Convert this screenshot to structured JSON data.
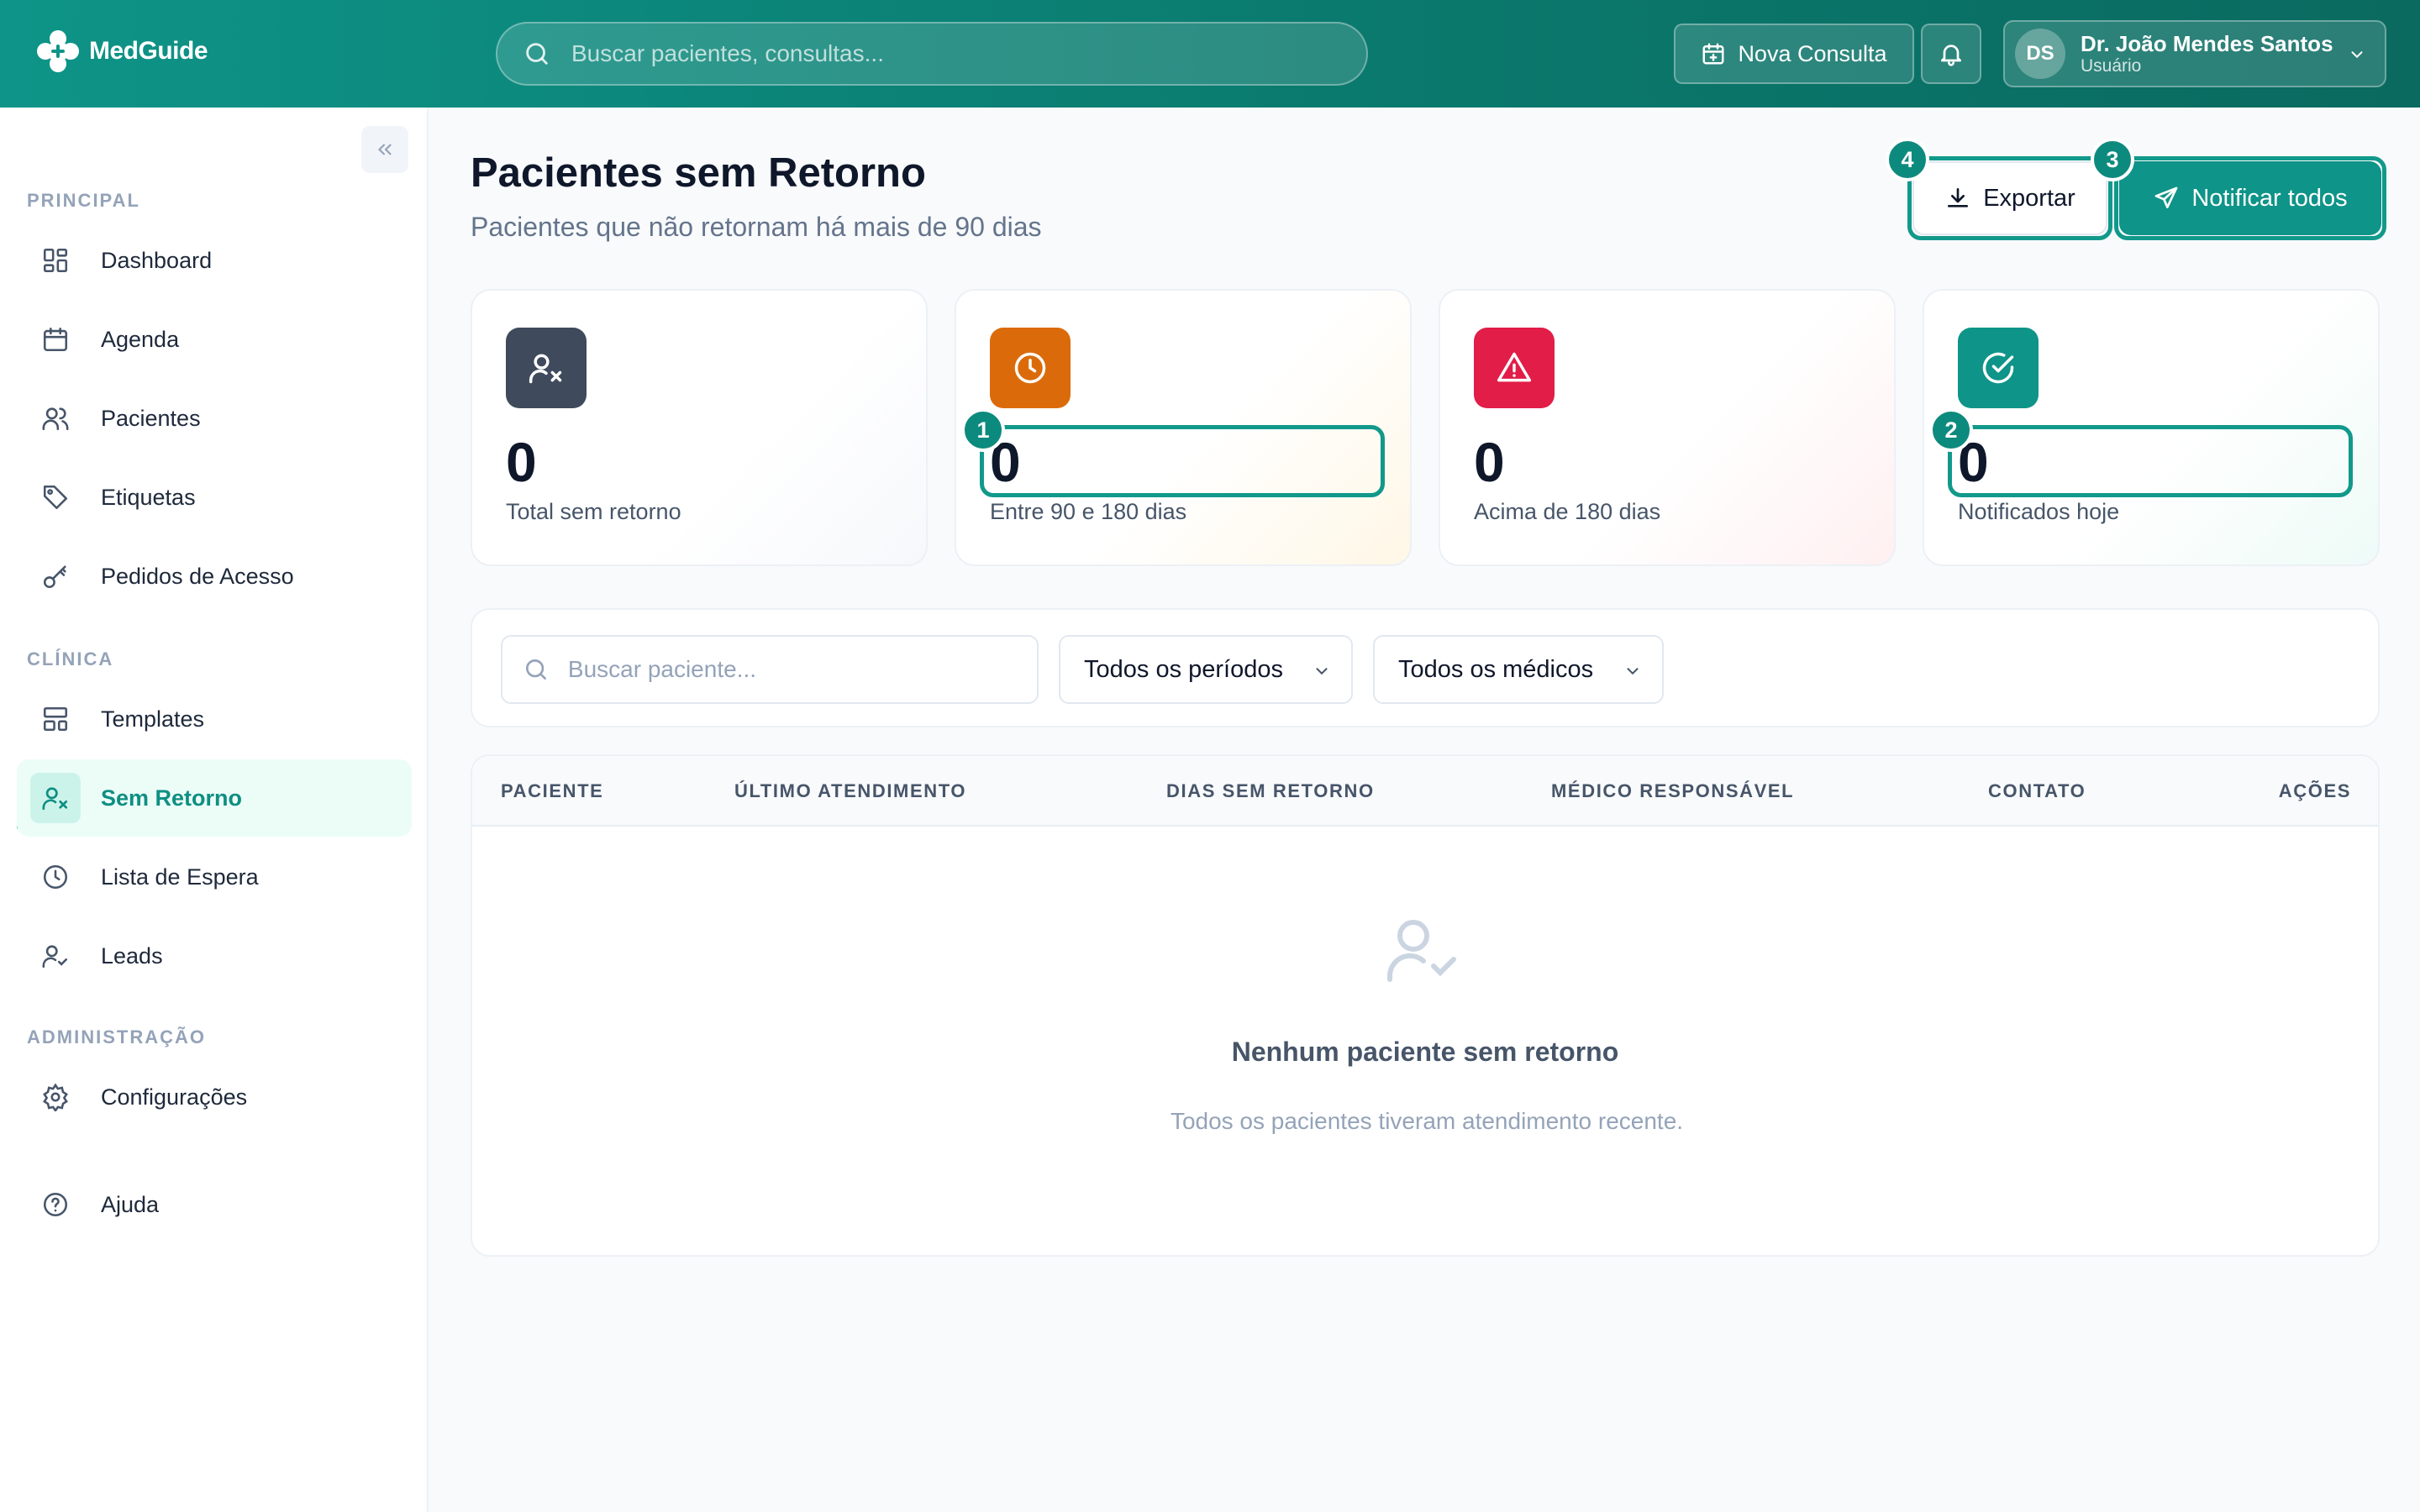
{
  "app": {
    "name": "MedGuide",
    "search_placeholder": "Buscar pacientes, consultas...",
    "new_consult_label": "Nova Consulta",
    "user": {
      "initials": "DS",
      "name": "Dr. João Mendes Santos",
      "role": "Usuário"
    }
  },
  "sidebar": {
    "sections": [
      {
        "label": "PRINCIPAL"
      },
      {
        "label": "CLÍNICA"
      },
      {
        "label": "ADMINISTRAÇÃO"
      }
    ],
    "items": [
      {
        "label": "Dashboard",
        "icon": "dashboard-icon"
      },
      {
        "label": "Agenda",
        "icon": "calendar-icon"
      },
      {
        "label": "Pacientes",
        "icon": "users-icon"
      },
      {
        "label": "Etiquetas",
        "icon": "tag-icon"
      },
      {
        "label": "Pedidos de Acesso",
        "icon": "key-icon"
      },
      {
        "label": "Templates",
        "icon": "layout-icon"
      },
      {
        "label": "Sem Retorno",
        "icon": "user-x-icon",
        "active": true
      },
      {
        "label": "Lista de Espera",
        "icon": "clock-icon"
      },
      {
        "label": "Leads",
        "icon": "user-check-icon"
      },
      {
        "label": "Configurações",
        "icon": "gear-icon"
      },
      {
        "label": "Ajuda",
        "icon": "help-circle-icon"
      }
    ]
  },
  "page": {
    "title": "Pacientes sem Retorno",
    "subtitle": "Pacientes que não retornam há mais de 90 dias",
    "export_label": "Exportar",
    "notify_label": "Notificar todos"
  },
  "stats": [
    {
      "value": "0",
      "label": "Total sem retorno",
      "color": "#3f4a5c",
      "icon": "user-x-icon"
    },
    {
      "value": "0",
      "label": "Entre 90 e 180 dias",
      "color": "#db6b0a",
      "icon": "clock-icon"
    },
    {
      "value": "0",
      "label": "Acima de 180 dias",
      "color": "#e11d48",
      "icon": "alert-triangle-icon"
    },
    {
      "value": "0",
      "label": "Notificados hoje",
      "color": "#0e9488",
      "icon": "check-circle-icon"
    }
  ],
  "annotations": [
    "1",
    "2",
    "3",
    "4"
  ],
  "filters": {
    "search_placeholder": "Buscar paciente...",
    "period_selected": "Todos os períodos",
    "doctor_selected": "Todos os médicos"
  },
  "table": {
    "columns": [
      "PACIENTE",
      "ÚLTIMO ATENDIMENTO",
      "DIAS SEM RETORNO",
      "MÉDICO RESPONSÁVEL",
      "CONTATO",
      "AÇÕES"
    ],
    "empty_title": "Nenhum paciente sem retorno",
    "empty_subtitle": "Todos os pacientes tiveram atendimento recente."
  },
  "colors": {
    "brand": "#0e9488",
    "brand_dark": "#0a6a60"
  }
}
